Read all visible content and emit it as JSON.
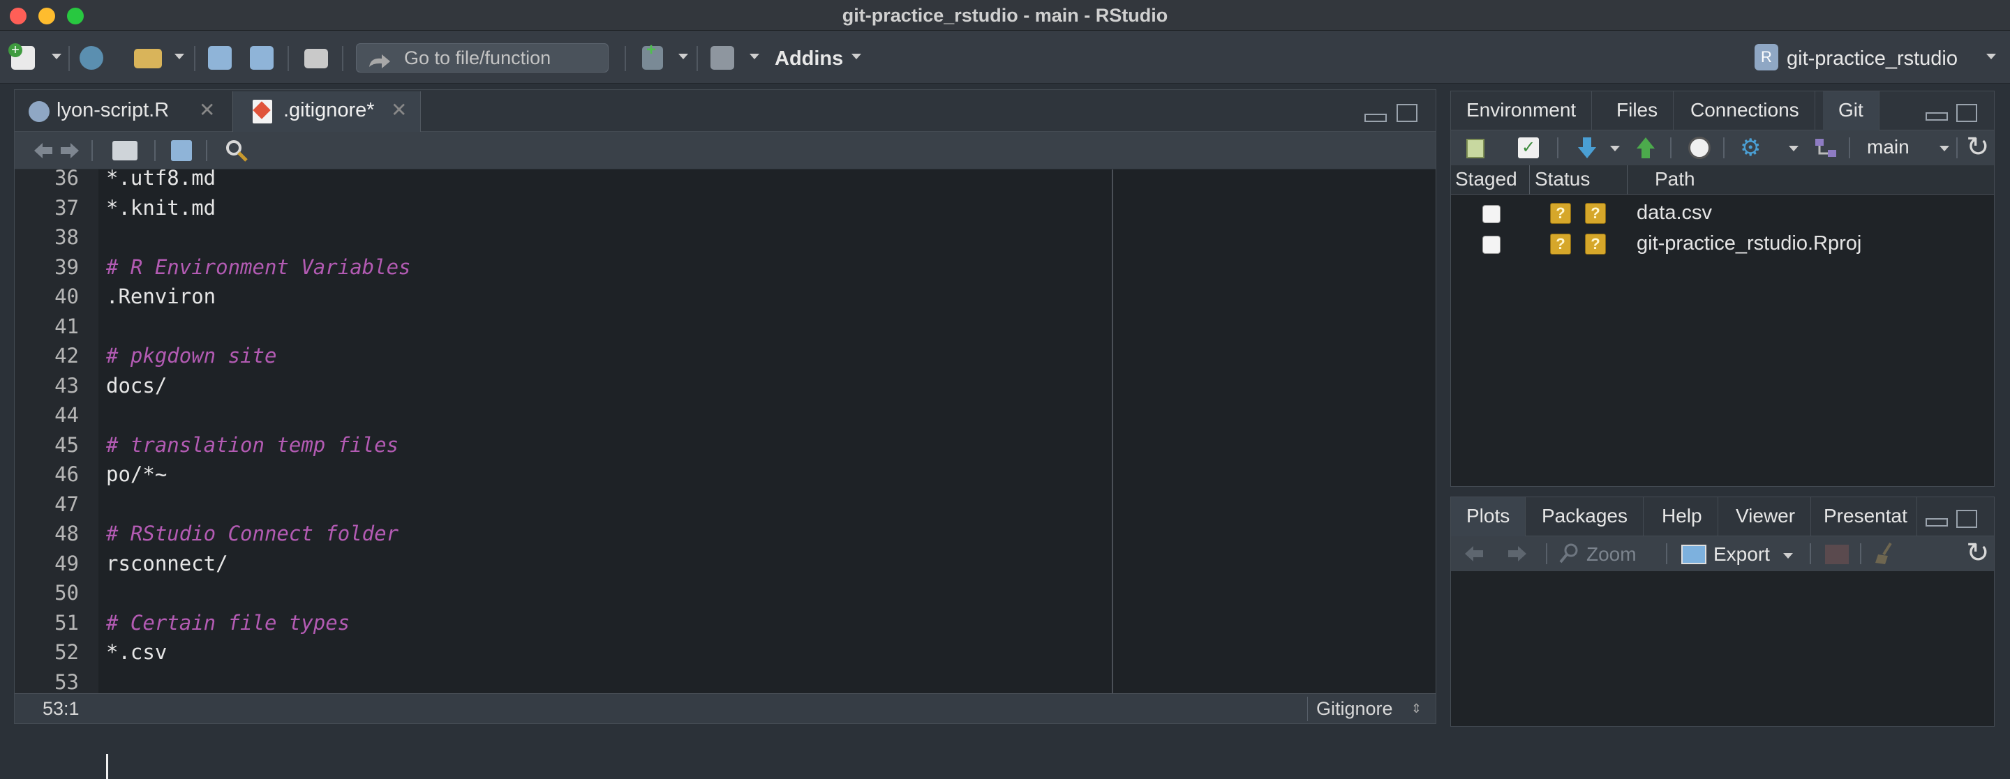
{
  "window": {
    "title": "git-practice_rstudio - main - RStudio"
  },
  "toolbar": {
    "goto_placeholder": "Go to file/function",
    "addins_label": "Addins",
    "project_label": "git-practice_rstudio"
  },
  "editor": {
    "tabs": [
      {
        "label": "lyon-script.R",
        "active": false
      },
      {
        "label": ".gitignore*",
        "active": true
      }
    ],
    "lines": [
      {
        "num": "36",
        "text": "*.utf8.md",
        "comment": false
      },
      {
        "num": "37",
        "text": "*.knit.md",
        "comment": false
      },
      {
        "num": "38",
        "text": "",
        "comment": false
      },
      {
        "num": "39",
        "text": "# R Environment Variables",
        "comment": true
      },
      {
        "num": "40",
        "text": ".Renviron",
        "comment": false
      },
      {
        "num": "41",
        "text": "",
        "comment": false
      },
      {
        "num": "42",
        "text": "# pkgdown site",
        "comment": true
      },
      {
        "num": "43",
        "text": "docs/",
        "comment": false
      },
      {
        "num": "44",
        "text": "",
        "comment": false
      },
      {
        "num": "45",
        "text": "# translation temp files",
        "comment": true
      },
      {
        "num": "46",
        "text": "po/*~",
        "comment": false
      },
      {
        "num": "47",
        "text": "",
        "comment": false
      },
      {
        "num": "48",
        "text": "# RStudio Connect folder",
        "comment": true
      },
      {
        "num": "49",
        "text": "rsconnect/",
        "comment": false
      },
      {
        "num": "50",
        "text": "",
        "comment": false
      },
      {
        "num": "51",
        "text": "# Certain file types",
        "comment": true
      },
      {
        "num": "52",
        "text": "*.csv",
        "comment": false
      },
      {
        "num": "53",
        "text": "",
        "comment": false
      }
    ],
    "cursor_position": "53:1",
    "file_type": "Gitignore"
  },
  "git_pane": {
    "tabs": [
      "Environment",
      "Files",
      "Connections",
      "Git"
    ],
    "active_tab": "Git",
    "branch": "main",
    "columns": {
      "staged": "Staged",
      "status": "Status",
      "path": "Path"
    },
    "files": [
      {
        "staged": false,
        "status": [
          "?",
          "?"
        ],
        "path": "data.csv"
      },
      {
        "staged": false,
        "status": [
          "?",
          "?"
        ],
        "path": "git-practice_rstudio.Rproj"
      }
    ]
  },
  "plots_pane": {
    "tabs": [
      "Plots",
      "Packages",
      "Help",
      "Viewer",
      "Presentat"
    ],
    "active_tab": "Plots",
    "zoom_label": "Zoom",
    "export_label": "Export"
  },
  "colors": {
    "comment": "#b35bb3",
    "editor_bg": "#1e2226",
    "status_untracked": "#d6a72a"
  }
}
